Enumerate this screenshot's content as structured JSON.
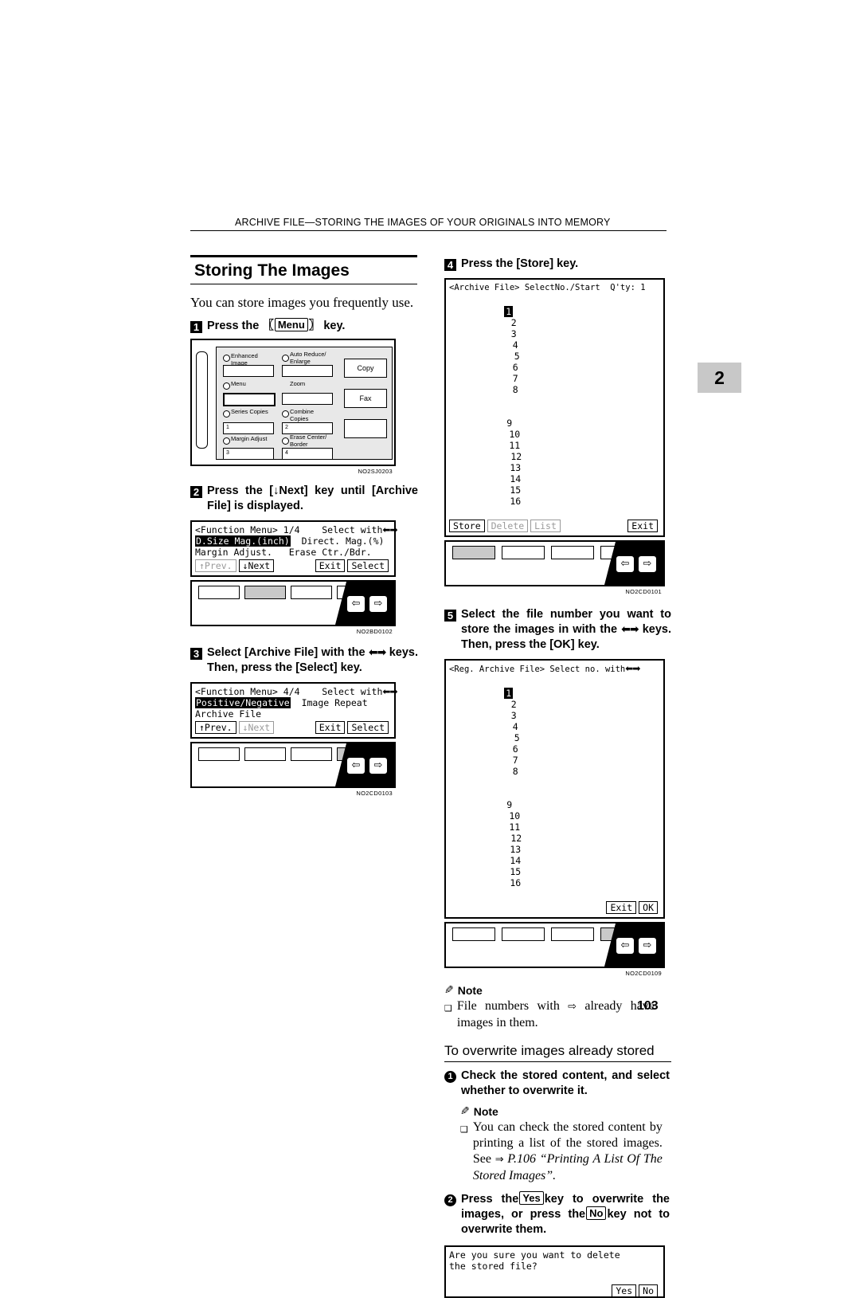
{
  "header": {
    "running_head": "ARCHIVE FILE—STORING THE IMAGES OF YOUR ORIGINALS INTO MEMORY",
    "chapter_tab": "2",
    "page_number": "103"
  },
  "left_column": {
    "title": "Storing The Images",
    "intro": "You can store images you frequently use.",
    "step1": {
      "num": "1",
      "text_pre": "Press the",
      "key": "Menu",
      "text_post": "key.",
      "figure_code": "NO2SJ0203",
      "panel": {
        "cells": [
          {
            "label": "Enhanced Image",
            "number": ""
          },
          {
            "label": "Auto Reduce/ Enlarge",
            "number": ""
          },
          {
            "label": "Menu",
            "number": ""
          },
          {
            "label": "Zoom",
            "number": ""
          },
          {
            "label": "Series Copies",
            "number": "1"
          },
          {
            "label": "Combine Copies",
            "number": "2"
          },
          {
            "label": "Margin Adjust",
            "number": "3"
          },
          {
            "label": "Erase Center/ Border",
            "number": "4"
          }
        ],
        "big_buttons": [
          "Copy",
          "Fax",
          ""
        ]
      }
    },
    "step2": {
      "num": "2",
      "text": "Press the [↓Next] key until [Archive File] is displayed.",
      "lcd": {
        "title": "<Function Menu> 1/4    Select with",
        "rows": [
          [
            "D.Size Mag.(inch)",
            "Direct. Mag.(%)"
          ],
          [
            "Margin Adjust.",
            "Erase Ctr./Bdr."
          ]
        ],
        "buttons": [
          "↑Prev.",
          "↓Next",
          "Exit",
          "Select"
        ]
      },
      "figure_code": "NO2BD0102"
    },
    "step3": {
      "num": "3",
      "text_a": "Select [Archive File] with the",
      "text_b": "keys. Then, press the [Select] key.",
      "lcd": {
        "title": "<Function Menu> 4/4    Select with",
        "rows": [
          [
            "Positive/Negative",
            "Image Repeat"
          ],
          [
            "Archive File",
            ""
          ]
        ],
        "buttons": [
          "↑Prev.",
          "↓Next",
          "Exit",
          "Select"
        ]
      },
      "figure_code": "NO2CD0103"
    }
  },
  "right_column": {
    "step4": {
      "num": "4",
      "text_pre": "Press the [Store] key.",
      "lcd": {
        "title": "<Archive File> SelectNo./Start  Q'ty: 1",
        "row1": [
          "1",
          "2",
          "3",
          "4",
          "5",
          "6",
          "7",
          "8"
        ],
        "row2": [
          "9",
          "10",
          "11",
          "12",
          "13",
          "14",
          "15",
          "16"
        ],
        "selected_index": 0,
        "buttons": [
          "Store",
          "Delete",
          "List",
          "Exit"
        ]
      },
      "figure_code": "NO2CD0101"
    },
    "step5": {
      "num": "5",
      "text": "Select the file number you want to store the images in with the",
      "text2": "keys. Then, press the [OK] key.",
      "lcd": {
        "title": "<Reg. Archive File> Select no. with",
        "row1": [
          "1",
          "2",
          "3",
          "4",
          "5",
          "6",
          "7",
          "8"
        ],
        "row2": [
          "9",
          "10",
          "11",
          "12",
          "13",
          "14",
          "15",
          "16"
        ],
        "selected_index": 0,
        "buttons": [
          "Exit",
          "OK"
        ]
      },
      "figure_code": "NO2CD0109"
    },
    "note1": {
      "label": "Note",
      "text_a": "File numbers with",
      "text_b": "already have images in them."
    },
    "subsection": {
      "title": "To overwrite images already stored",
      "step_a": {
        "num": "1",
        "text": "Check the stored content, and select whether to overwrite it."
      },
      "note2": {
        "label": "Note",
        "text": "You can check the stored content by printing a list of the stored images. See",
        "ref": "P.106 “Printing A List Of The Stored Images”."
      },
      "step_b": {
        "num": "2",
        "text_1": "Press the",
        "key_yes": "Yes",
        "text_2": "key to overwrite the images, or press the",
        "key_no": "No",
        "text_3": "key not to overwrite them."
      },
      "lcd": {
        "line1": "Are you sure you want to delete",
        "line2": "the stored file?",
        "buttons": [
          "Yes",
          "No"
        ]
      }
    }
  },
  "icons": {
    "left_arrow": "⬅",
    "right_arrow": "➡",
    "note_pencil": "✎",
    "bullet_box": "❐",
    "arrow_ref": "⇒"
  }
}
